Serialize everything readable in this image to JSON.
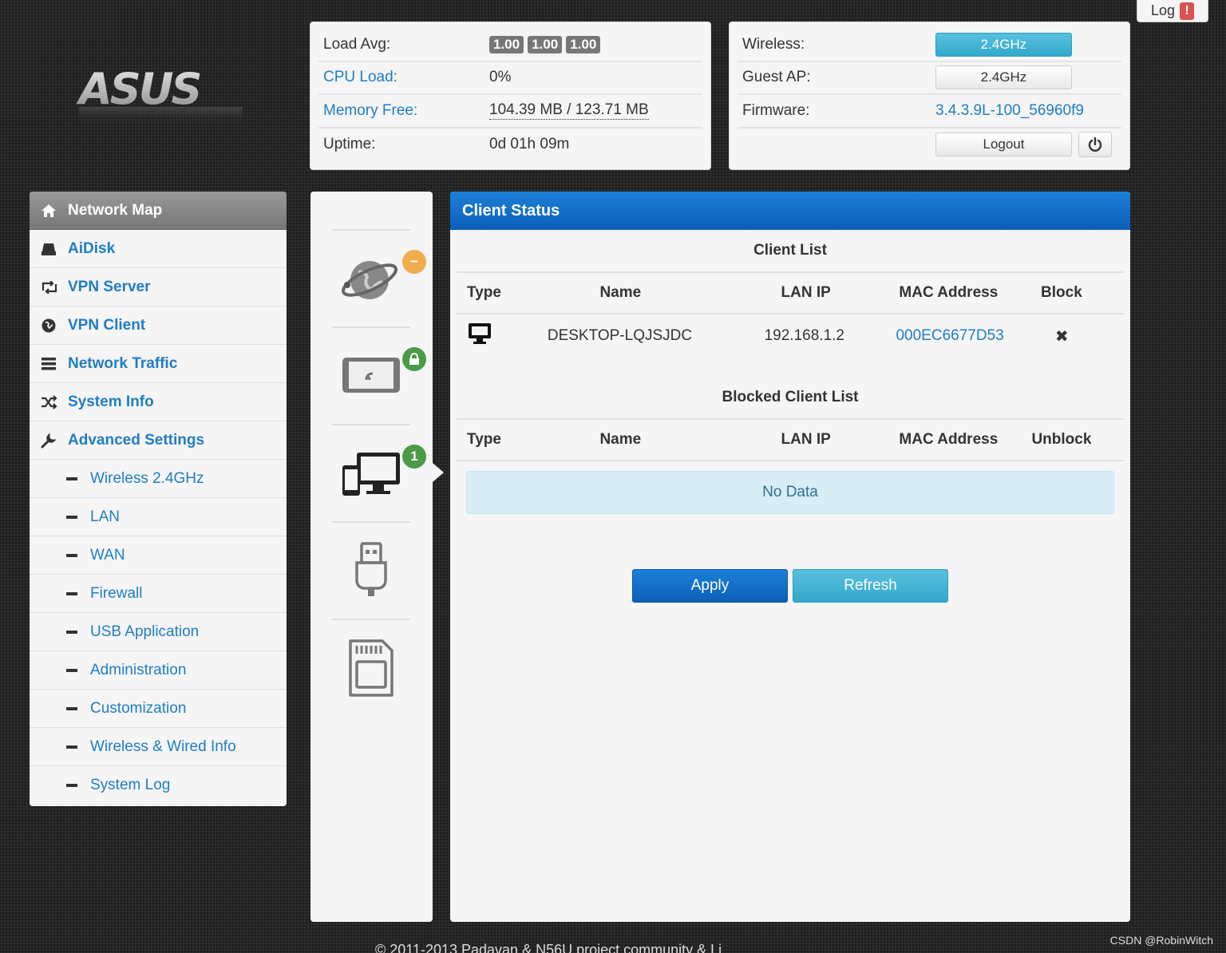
{
  "log_button": {
    "label": "Log",
    "alert": "!"
  },
  "logo": {
    "text": "ASUS"
  },
  "status": {
    "load_avg_label": "Load Avg:",
    "load_avg": [
      "1.00",
      "1.00",
      "1.00"
    ],
    "cpu_label": "CPU Load:",
    "cpu_value": "0%",
    "mem_label": "Memory Free:",
    "mem_value": "104.39 MB / 123.71 MB",
    "uptime_label": "Uptime:",
    "uptime_value": "0d 01h 09m"
  },
  "device": {
    "wireless_label": "Wireless:",
    "wireless_value": "2.4GHz",
    "guest_label": "Guest AP:",
    "guest_value": "2.4GHz",
    "firmware_label": "Firmware:",
    "firmware_value": "3.4.3.9L-100_56960f9",
    "logout_label": "Logout"
  },
  "sidebar": {
    "items": [
      {
        "label": "Network Map",
        "icon": "home-icon"
      },
      {
        "label": "AiDisk",
        "icon": "drive-icon"
      },
      {
        "label": "VPN Server",
        "icon": "retweet-icon"
      },
      {
        "label": "VPN Client",
        "icon": "globe-icon"
      },
      {
        "label": "Network Traffic",
        "icon": "list-icon"
      },
      {
        "label": "System Info",
        "icon": "random-icon"
      },
      {
        "label": "Advanced Settings",
        "icon": "wrench-icon"
      }
    ],
    "sub_items": [
      "Wireless 2.4GHz",
      "LAN",
      "WAN",
      "Firewall",
      "USB Application",
      "Administration",
      "Customization",
      "Wireless & Wired Info",
      "System Log"
    ]
  },
  "icon_column": {
    "internet_badge": "−",
    "clients_badge": "1"
  },
  "main": {
    "header": "Client Status",
    "client_list_title": "Client List",
    "columns": {
      "type": "Type",
      "name": "Name",
      "ip": "LAN IP",
      "mac": "MAC Address",
      "block": "Block",
      "unblock": "Unblock"
    },
    "clients": [
      {
        "name": "DESKTOP-LQJSJDC",
        "ip": "192.168.1.2",
        "mac": "000EC6677D53",
        "block": "✖"
      }
    ],
    "blocked_title": "Blocked Client List",
    "no_data": "No Data",
    "apply_label": "Apply",
    "refresh_label": "Refresh"
  },
  "footer": "© 2011-2013 Padavan & N56U project community & Li",
  "watermark": "CSDN @RobinWitch",
  "colors": {
    "accent_blue": "#1f7dc2",
    "header_blue": "#0b5fb8",
    "info_blue": "#5bc0de",
    "warning_orange": "#f0ad4e",
    "success_green": "#4a9a48"
  }
}
